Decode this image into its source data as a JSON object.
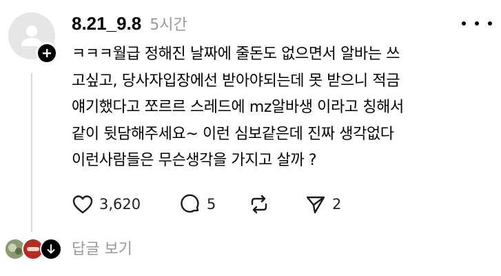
{
  "post": {
    "username": "8.21_9.8",
    "timestamp": "5시간",
    "text": "ㅋㅋㅋ월급 정해진 날짜에 줄돈도 없으면서 알바는 쓰\n고싶고, 당사자입장에선 받아야되는데 못 받으니 적금\n얘기했다고 쪼르르 스레드에 mz알바생 이라고 칭해서\n같이 뒷담해주세요~ 이런 심보같은데 진짜 생각없다\n이런사람들은 무슨생각을 가지고 살까 ?",
    "avatar_icon": "default-user-icon",
    "follow_icon": "plus-icon",
    "more_icon": "more-horizontal-icon"
  },
  "actions": {
    "likes": "3,620",
    "replies": "5",
    "shares": "2",
    "like_icon": "heart-icon",
    "reply_icon": "comment-icon",
    "repost_icon": "repost-icon",
    "share_icon": "send-icon"
  },
  "replies_footer": {
    "label": "답글 보기",
    "avatar_icons": [
      "reply-avatar",
      "reply-avatar",
      "arrow-down-icon"
    ]
  },
  "colors": {
    "text": "#000000",
    "muted": "#999999",
    "thread_line": "#d9d9d9",
    "avatar_bg": "#e6e6e6"
  }
}
